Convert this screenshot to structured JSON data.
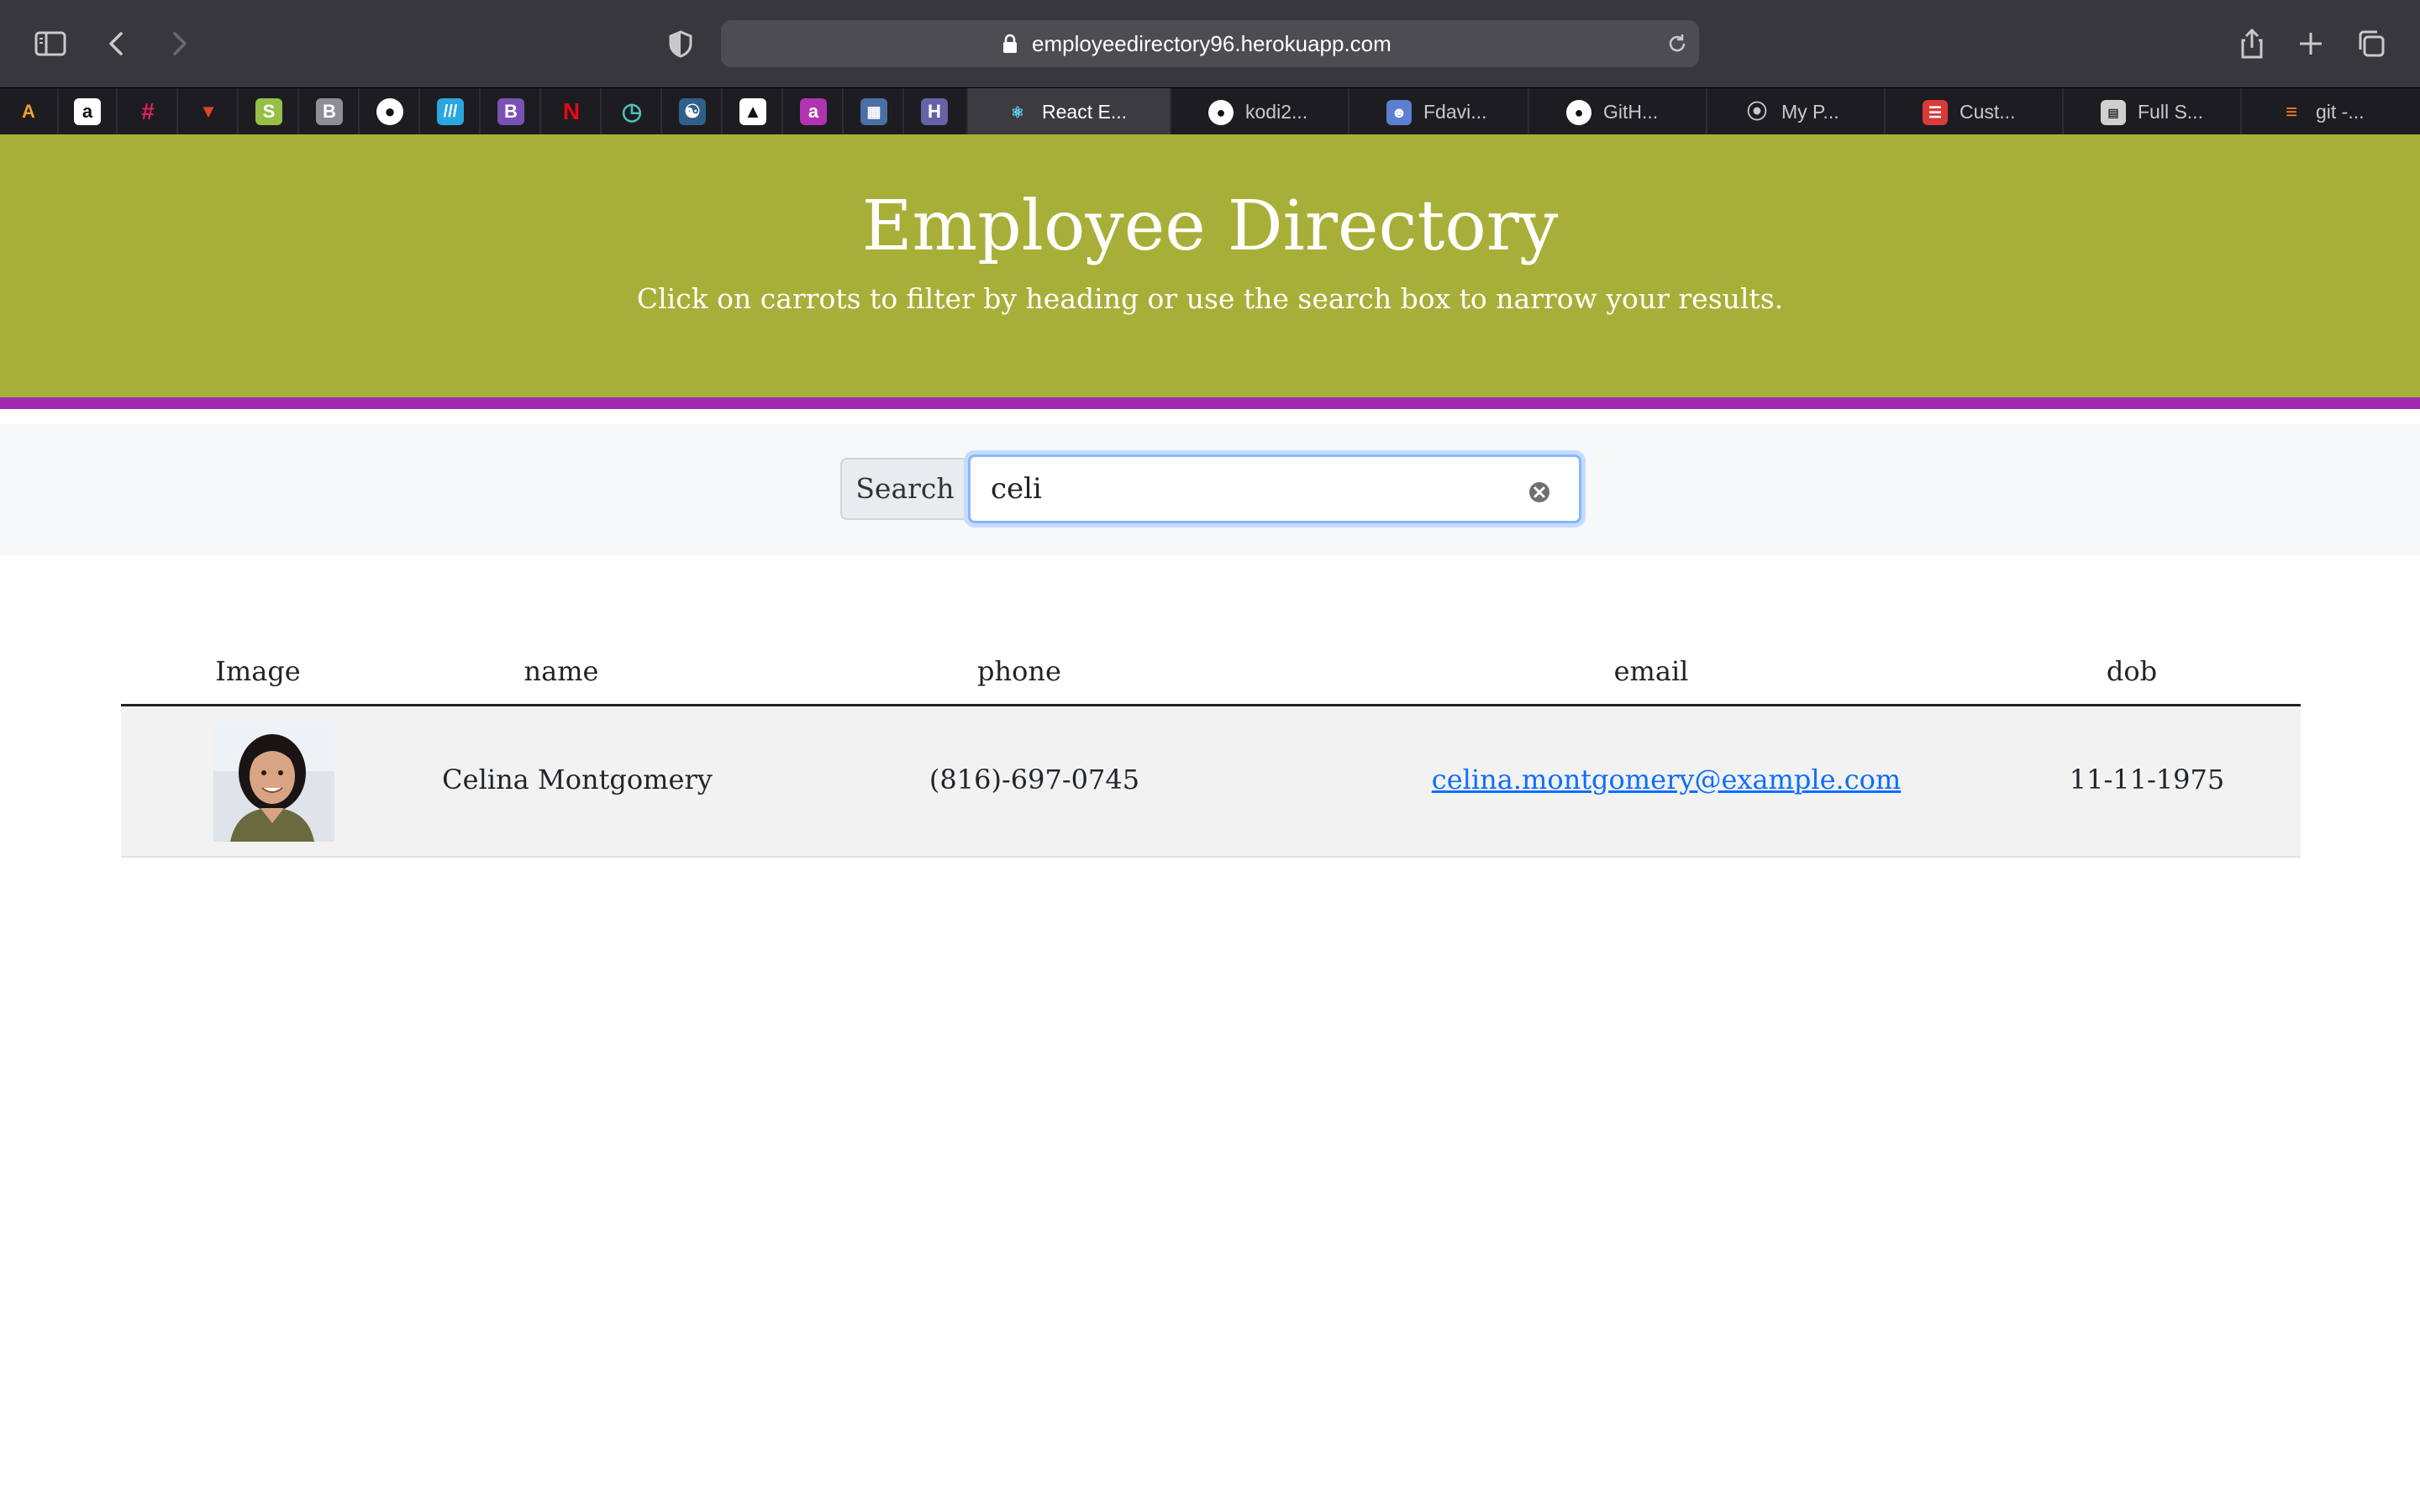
{
  "browser": {
    "url": "employeedirectory96.herokuapp.com",
    "tabs": [
      {
        "label": "React E...",
        "active": true,
        "icon": "react-icon"
      },
      {
        "label": "kodi2...",
        "active": false,
        "icon": "github-icon"
      },
      {
        "label": "Fdavi...",
        "active": false,
        "icon": "avatar-icon"
      },
      {
        "label": "GitH...",
        "active": false,
        "icon": "github-icon"
      },
      {
        "label": "My P...",
        "active": false,
        "icon": "compass-icon"
      },
      {
        "label": "Cust...",
        "active": false,
        "icon": "form-icon"
      },
      {
        "label": "Full S...",
        "active": false,
        "icon": "bootcamp-icon"
      },
      {
        "label": "git -...",
        "active": false,
        "icon": "stackoverflow-icon"
      }
    ],
    "pinned_icons": [
      "aws-icon",
      "amazon-icon",
      "slack-icon",
      "gitlab-icon",
      "shopify-icon",
      "bootstrap-icon",
      "github-icon",
      "stripes-icon",
      "bootstrap-icon",
      "netflix-icon",
      "clock-icon",
      "octopus-icon",
      "grad-cap-icon",
      "app-icon",
      "network-icon",
      "heroku-icon"
    ]
  },
  "header": {
    "title": "Employee Directory",
    "subtitle": "Click on carrots to filter by heading or use the search box to narrow your results."
  },
  "search": {
    "label": "Search",
    "value": "celi"
  },
  "table": {
    "headers": [
      "Image",
      "name",
      "phone",
      "email",
      "dob"
    ],
    "rows": [
      {
        "name": "Celina Montgomery",
        "phone": "(816)-697-0745",
        "email": "celina.montgomery@example.com",
        "dob": "11-11-1975"
      }
    ]
  },
  "colors": {
    "header_bg": "#a8af38",
    "header_border": "#9f2cb0",
    "link": "#0d6efd"
  }
}
